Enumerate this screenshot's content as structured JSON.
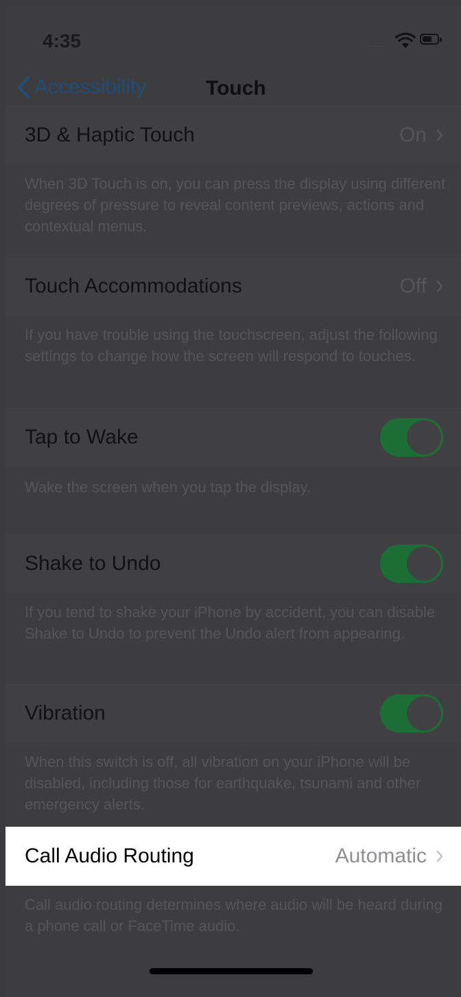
{
  "status": {
    "time": "4:35",
    "signal": "....."
  },
  "nav": {
    "back_label": "Accessibility",
    "title": "Touch"
  },
  "rows": {
    "haptic": {
      "label": "3D & Haptic Touch",
      "value": "On",
      "desc": "When 3D Touch is on, you can press the display using different degrees of pressure to reveal content previews, actions and contextual menus."
    },
    "accommodations": {
      "label": "Touch Accommodations",
      "value": "Off",
      "desc": "If you have trouble using the touchscreen, adjust the following settings to change how the screen will respond to touches."
    },
    "tap_to_wake": {
      "label": "Tap to Wake",
      "on": true,
      "desc": "Wake the screen when you tap the display."
    },
    "shake_to_undo": {
      "label": "Shake to Undo",
      "on": true,
      "desc": "If you tend to shake your iPhone by accident, you can disable Shake to Undo to prevent the Undo alert from appearing."
    },
    "vibration": {
      "label": "Vibration",
      "on": true,
      "desc": "When this switch is off, all vibration on your iPhone will be disabled, including those for earthquake, tsunami and other emergency alerts."
    },
    "call_audio": {
      "label": "Call Audio Routing",
      "value": "Automatic",
      "desc": "Call audio routing determines where audio will be heard during a phone call or FaceTime audio."
    }
  },
  "colors": {
    "toggle_on": "#1d6e36",
    "link": "#1e4d7a",
    "highlight_bg": "#ffffff"
  },
  "icons": {
    "back": "chevron-left-icon",
    "disclosure": "chevron-right-icon",
    "wifi": "wifi-icon",
    "battery": "battery-icon"
  }
}
